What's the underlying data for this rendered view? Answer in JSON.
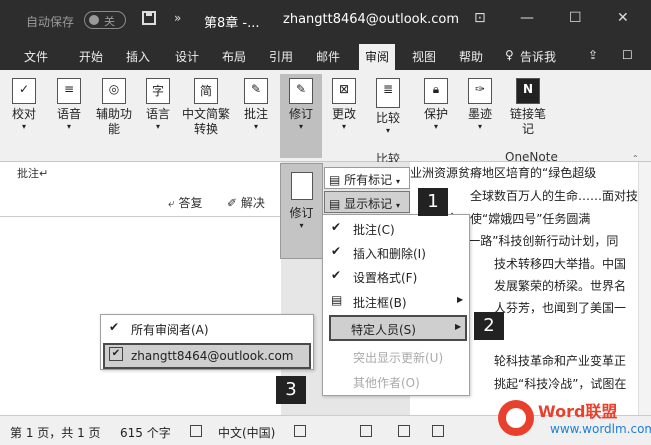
{
  "titlebar": {
    "autosave_label": "自动保存",
    "autosave_state": "关",
    "quick_more": "»",
    "doc_title": "第8章 -...",
    "user_email": "zhangtt8464@outlook.com"
  },
  "tabs": [
    "文件",
    "开始",
    "插入",
    "设计",
    "布局",
    "引用",
    "邮件",
    "审阅",
    "视图",
    "帮助",
    "告诉我"
  ],
  "ribbon": {
    "buttons": [
      {
        "label": "校对",
        "caret": true
      },
      {
        "label": "语音",
        "caret": true
      },
      {
        "label": "辅助功能",
        "caret": true
      },
      {
        "label": "语言",
        "caret": true
      },
      {
        "label": "中文简繁转换",
        "caret": true
      },
      {
        "label": "批注",
        "caret": true
      },
      {
        "label": "修订",
        "caret": true
      },
      {
        "label": "更改",
        "caret": true
      },
      {
        "label": "比较",
        "caret": true
      },
      {
        "label": "保护",
        "caret": true
      },
      {
        "label": "墨迹",
        "caret": true
      },
      {
        "label": "链接笔记",
        "caret": false
      }
    ],
    "group_compare": "比较",
    "group_onenote": "OneNote"
  },
  "document": {
    "comment_placeholder": "批注↵",
    "reply_label": "答复",
    "resolve_label": "解决",
    "lines": [
      "业洲资源贫瘠地区培育的“绿色超级",
      "全球数百万人的生命……面对技",
      "命，使“嫦娥四号”任务圆满",
      "“带一路”科技创新行动计划，同",
      "技术转移四大举措。中国",
      "发展繁荣的桥梁。世界名",
      "人芬芳，也闻到了美国一",
      "",
      "",
      "轮科技革命和产业变革正",
      "挑起“科技冷战”，试图在",
      ""
    ]
  },
  "revision_panel": {
    "label": "修订",
    "all_markup_label": "所有标记",
    "show_markup_label": "显示标记"
  },
  "show_markup_menu": {
    "items": [
      {
        "label": "批注(C)",
        "checked": true
      },
      {
        "label": "插入和删除(I)",
        "checked": true
      },
      {
        "label": "设置格式(F)",
        "checked": true
      },
      {
        "label": "批注框(B)",
        "checked": false,
        "submenu": true
      },
      {
        "label": "特定人员(S)",
        "checked": false,
        "submenu": true
      },
      {
        "label": "突出显示更新(U)",
        "checked": false,
        "disabled": true
      },
      {
        "label": "其他作者(O)",
        "checked": false,
        "disabled": true
      }
    ]
  },
  "people_submenu": {
    "items": [
      {
        "label": "所有审阅者(A)",
        "checked": true
      },
      {
        "label": "zhangtt8464@outlook.com",
        "checked": true
      }
    ]
  },
  "callouts": [
    "1",
    "2",
    "3"
  ],
  "statusbar": {
    "page": "第 1 页，共 1 页",
    "words": "615 个字",
    "language": "中文(中国)"
  },
  "watermark": {
    "title": "Word联盟",
    "url": "www.wordlm.com"
  },
  "colors": {
    "titlebar": "#2d2d2d",
    "ribbon": "#f0f0f0",
    "highlight": "#cfcfcf",
    "watermark_red": "#e8402d",
    "watermark_blue": "#1e7fd6"
  }
}
